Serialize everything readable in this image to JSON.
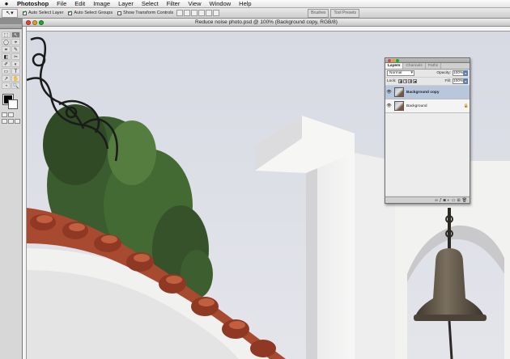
{
  "menubar": {
    "apple_icon": "apple-icon",
    "items": [
      "Photoshop",
      "File",
      "Edit",
      "Image",
      "Layer",
      "Select",
      "Filter",
      "View",
      "Window",
      "Help"
    ]
  },
  "options": {
    "auto_select_layer": "Auto Select Layer",
    "auto_select_groups": "Auto Select Groups",
    "show_transform": "Show Transform Controls",
    "well_tabs": [
      "Brushes",
      "Tool Presets"
    ]
  },
  "toolbox": {
    "tools": [
      "⬚",
      "↖",
      "◯",
      "⌖",
      "⌗",
      "✎",
      "◧",
      "✂",
      "✐",
      "◐",
      "▭",
      "T",
      "↗",
      "✋",
      "◔",
      "🔍"
    ],
    "active_index": 1,
    "foreground_color": "#000000",
    "background_color": "#ffffff"
  },
  "document": {
    "title": "Reduce noise photo.psd @ 100% (Background copy, RGB/8)"
  },
  "layers_panel": {
    "tabs": [
      "Layers",
      "Channels",
      "Paths"
    ],
    "active_tab": 0,
    "blend_mode": "Normal",
    "opacity_label": "Opacity:",
    "opacity_value": "100%",
    "lock_label": "Lock:",
    "fill_label": "Fill:",
    "fill_value": "100%",
    "layers": [
      {
        "name": "Background copy",
        "selected": true,
        "locked": false
      },
      {
        "name": "Background",
        "selected": false,
        "locked": true
      }
    ],
    "footer_icons": [
      "link-icon",
      "fx-icon",
      "mask-icon",
      "adjustment-icon",
      "folder-icon",
      "new-layer-icon",
      "trash-icon"
    ]
  },
  "colors": {
    "sky": "#dde0e8",
    "roof_tile": "#a84a30",
    "wall": "#f4f4f3",
    "tree": "#3b5c2e",
    "bell": "#5e5446"
  }
}
